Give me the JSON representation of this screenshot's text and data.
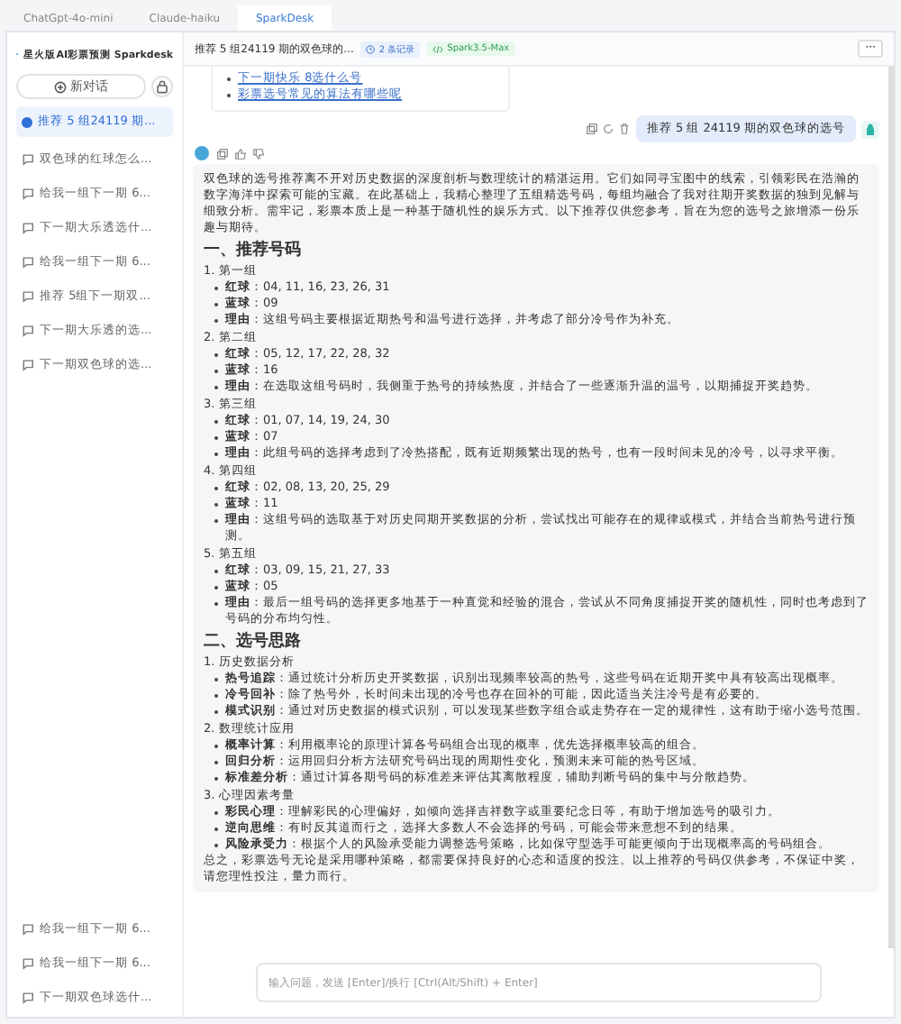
{
  "top_tabs": [
    {
      "label": "ChatGpt-4o-mini",
      "selected": false
    },
    {
      "label": "Claude-haiku",
      "selected": false
    },
    {
      "label": "SparkDesk",
      "selected": true
    }
  ],
  "sidebar": {
    "title": "星火版AI彩票预测 Sparkdesk",
    "new_chat": "新对话",
    "conversations": [
      {
        "label": "推荐 5 组24119 期...",
        "selected": true
      },
      {
        "label": "双色球的红球怎么...",
        "selected": false
      },
      {
        "label": "给我一组下一期 6...",
        "selected": false
      },
      {
        "label": "下一期大乐透选什...",
        "selected": false
      },
      {
        "label": "给我一组下一期 6...",
        "selected": false
      },
      {
        "label": "推荐 5组下一期双...",
        "selected": false
      },
      {
        "label": "下一期大乐透的选...",
        "selected": false
      },
      {
        "label": "下一期双色球的选...",
        "selected": false
      }
    ],
    "earlier_conversations": [
      {
        "label": "给我一组下一期 6...",
        "selected": false
      },
      {
        "label": "给我一组下一期 6...",
        "selected": false
      },
      {
        "label": "下一期双色球选什...",
        "selected": false
      }
    ]
  },
  "header": {
    "title": "推荐 5 组24119 期的双色球的...",
    "records": "2 条记录",
    "model": "Spark3.5-Max",
    "more": "···"
  },
  "suggestions": [
    "下一期快乐 8选什么号",
    "彩票选号常见的算法有哪些呢"
  ],
  "user_message": "推荐 5 组 24119 期的双色球的选号",
  "answer": {
    "intro": "双色球的选号推荐离不开对历史数据的深度剖析与数理统计的精湛运用。它们如同寻宝图中的线索，引领彩民在浩瀚的数字海洋中探索可能的宝藏。在此基础上，我精心整理了五组精选号码，每组均融合了我对往期开奖数据的独到见解与细致分析。需牢记，彩票本质上是一种基于随机性的娱乐方式。以下推荐仅供您参考，旨在为您的选号之旅增添一份乐趣与期待。",
    "sections": [
      {
        "heading": "一、推荐号码",
        "groups": [
          {
            "title": "1. 第一组",
            "items": [
              "**红球**：04, 11, 16, 23, 26, 31",
              "**蓝球**：09",
              "**理由**：这组号码主要根据近期热号和温号进行选择，并考虑了部分冷号作为补充。"
            ]
          },
          {
            "title": "2. 第二组",
            "items": [
              "**红球**：05, 12, 17, 22, 28, 32",
              "**蓝球**：16",
              "**理由**：在选取这组号码时，我侧重于热号的持续热度，并结合了一些逐渐升温的温号，以期捕捉开奖趋势。"
            ]
          },
          {
            "title": "3. 第三组",
            "items": [
              "**红球**：01, 07, 14, 19, 24, 30",
              "**蓝球**：07",
              "**理由**：此组号码的选择考虑到了冷热搭配，既有近期频繁出现的热号，也有一段时间未见的冷号，以寻求平衡。"
            ]
          },
          {
            "title": "4. 第四组",
            "items": [
              "**红球**：02, 08, 13, 20, 25, 29",
              "**蓝球**：11",
              "**理由**：这组号码的选取基于对历史同期开奖数据的分析，尝试找出可能存在的规律或模式，并结合当前热号进行预测。"
            ]
          },
          {
            "title": "5. 第五组",
            "items": [
              "**红球**：03, 09, 15, 21, 27, 33",
              "**蓝球**：05",
              "**理由**：最后一组号码的选择更多地基于一种直觉和经验的混合，尝试从不同角度捕捉开奖的随机性，同时也考虑到了号码的分布均匀性。"
            ]
          }
        ]
      },
      {
        "heading": "二、选号思路",
        "groups": [
          {
            "title": "1. 历史数据分析",
            "items": [
              "**热号追踪**：通过统计分析历史开奖数据，识别出现频率较高的热号，这些号码在近期开奖中具有较高出现概率。",
              "**冷号回补**：除了热号外，长时间未出现的冷号也存在回补的可能，因此适当关注冷号是有必要的。",
              "**模式识别**：通过对历史数据的模式识别，可以发现某些数字组合或走势存在一定的规律性，这有助于缩小选号范围。"
            ]
          },
          {
            "title": "2. 数理统计应用",
            "items": [
              "**概率计算**：利用概率论的原理计算各号码组合出现的概率，优先选择概率较高的组合。",
              "**回归分析**：运用回归分析方法研究号码出现的周期性变化，预测未来可能的热号区域。",
              "**标准差分析**：通过计算各期号码的标准差来评估其离散程度，辅助判断号码的集中与分散趋势。"
            ]
          },
          {
            "title": "3. 心理因素考量",
            "items": [
              "**彩民心理**：理解彩民的心理偏好，如倾向选择吉祥数字或重要纪念日等，有助于增加选号的吸引力。",
              "**逆向思维**：有时反其道而行之，选择大多数人不会选择的号码，可能会带来意想不到的结果。",
              "**风险承受力**：根据个人的风险承受能力调整选号策略，比如保守型选手可能更倾向于出现概率高的号码组合。"
            ]
          }
        ]
      }
    ],
    "conclusion": "总之，彩票选号无论是采用哪种策略，都需要保持良好的心态和适度的投注。以上推荐的号码仅供参考，不保证中奖，请您理性投注，量力而行。"
  },
  "input": {
    "placeholder": "输入问题，发送 [Enter]/换行 [Ctrl(Alt/Shift) + Enter]"
  }
}
